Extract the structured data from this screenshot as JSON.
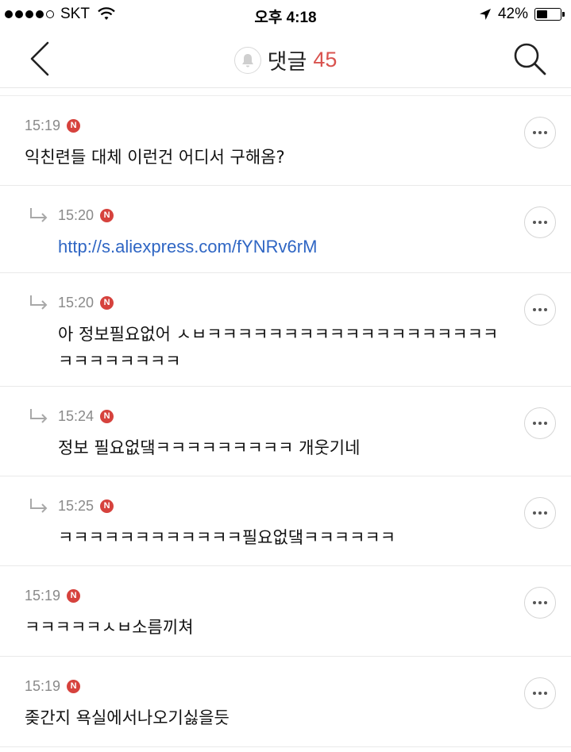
{
  "status_bar": {
    "carrier": "SKT",
    "time": "오후 4:18",
    "battery": "42%",
    "battery_level": 0.42
  },
  "nav": {
    "title": "댓글",
    "count": "45"
  },
  "badge_letter": "N",
  "comments": [
    {
      "time": "15:19",
      "text": "익친련들 대체 이런건 어디서 구해옴?",
      "reply": false
    },
    {
      "time": "15:20",
      "text": "http://s.aliexpress.com/fYNRv6rM",
      "reply": true,
      "link": true
    },
    {
      "time": "15:20",
      "text": "아 정보필요없어 ㅅㅂㅋㅋㅋㅋㅋㅋㅋㅋㅋㅋㅋㅋㅋㅋㅋㅋㅋㅋㅋㅋㅋㅋㅋㅋㅋㅋㅋ",
      "reply": true
    },
    {
      "time": "15:24",
      "text": "정보 필요없댘ㅋㅋㅋㅋㅋㅋㅋㅋㅋ 개웃기네",
      "reply": true
    },
    {
      "time": "15:25",
      "text": "ㅋㅋㅋㅋㅋㅋㅋㅋㅋㅋㅋㅋ필요없댘ㅋㅋㅋㅋㅋㅋ",
      "reply": true
    },
    {
      "time": "15:19",
      "text": "ㅋㅋㅋㅋㅋㅅㅂ소름끼쳐",
      "reply": false
    },
    {
      "time": "15:19",
      "text": "좆간지 욕실에서나오기싫을듯",
      "reply": false
    }
  ]
}
